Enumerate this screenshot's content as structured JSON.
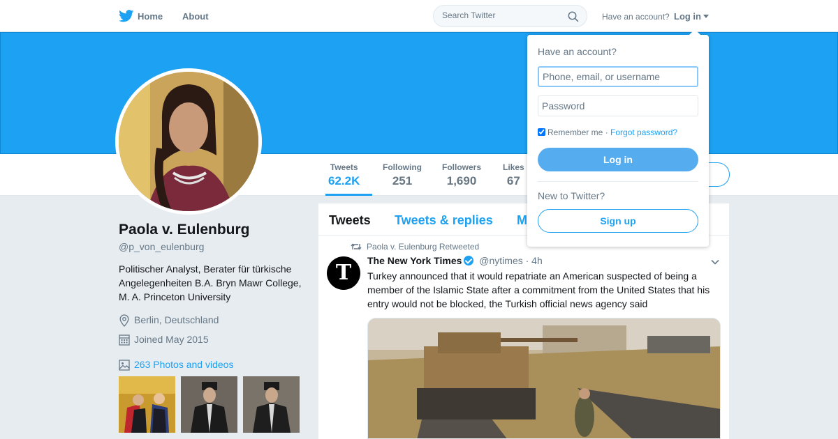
{
  "nav": {
    "home_label": "Home",
    "about_label": "About",
    "search_placeholder": "Search Twitter",
    "have_account": "Have an account?",
    "login_label": "Log in"
  },
  "profile": {
    "name": "Paola v. Eulenburg",
    "handle": "@p_von_eulenburg",
    "bio": "Politischer Analyst, Berater für türkische Angelegenheiten B.A. Bryn Mawr College, M. A. Princeton University",
    "location": "Berlin, Deutschland",
    "joined": "Joined May 2015",
    "photos_link": "263 Photos and videos"
  },
  "stats": [
    {
      "label": "Tweets",
      "value": "62.2K"
    },
    {
      "label": "Following",
      "value": "251"
    },
    {
      "label": "Followers",
      "value": "1,690"
    },
    {
      "label": "Likes",
      "value": "67"
    }
  ],
  "timeline": {
    "tabs": [
      "Tweets",
      "Tweets & replies",
      "M"
    ],
    "retweet_context": "Paola v. Eulenburg Retweeted",
    "tweet": {
      "avatar_letter": "T",
      "name": "The New York Times",
      "handle": "@nytimes",
      "time": "· 4h",
      "text": "Turkey announced that it would repatriate an American suspected of being a member of the Islamic State after a commitment from the United States that his entry would not be blocked, the Turkish official news agency said"
    }
  },
  "login_dropdown": {
    "heading": "Have an account?",
    "username_placeholder": "Phone, email, or username",
    "password_placeholder": "Password",
    "remember_label": "Remember me",
    "separator": " · ",
    "forgot_label": "Forgot password?",
    "login_button": "Log in",
    "new_to_twitter": "New to Twitter?",
    "signup_button": "Sign up"
  },
  "colors": {
    "brand_blue": "#1da1f2",
    "banner": "#1da1f2",
    "background": "#e6ecf0"
  },
  "icons": [
    "twitter-bird-icon",
    "search-icon",
    "location-pin-icon",
    "calendar-icon",
    "photo-icon",
    "retweet-icon",
    "verified-badge-icon",
    "chevron-down-icon"
  ]
}
